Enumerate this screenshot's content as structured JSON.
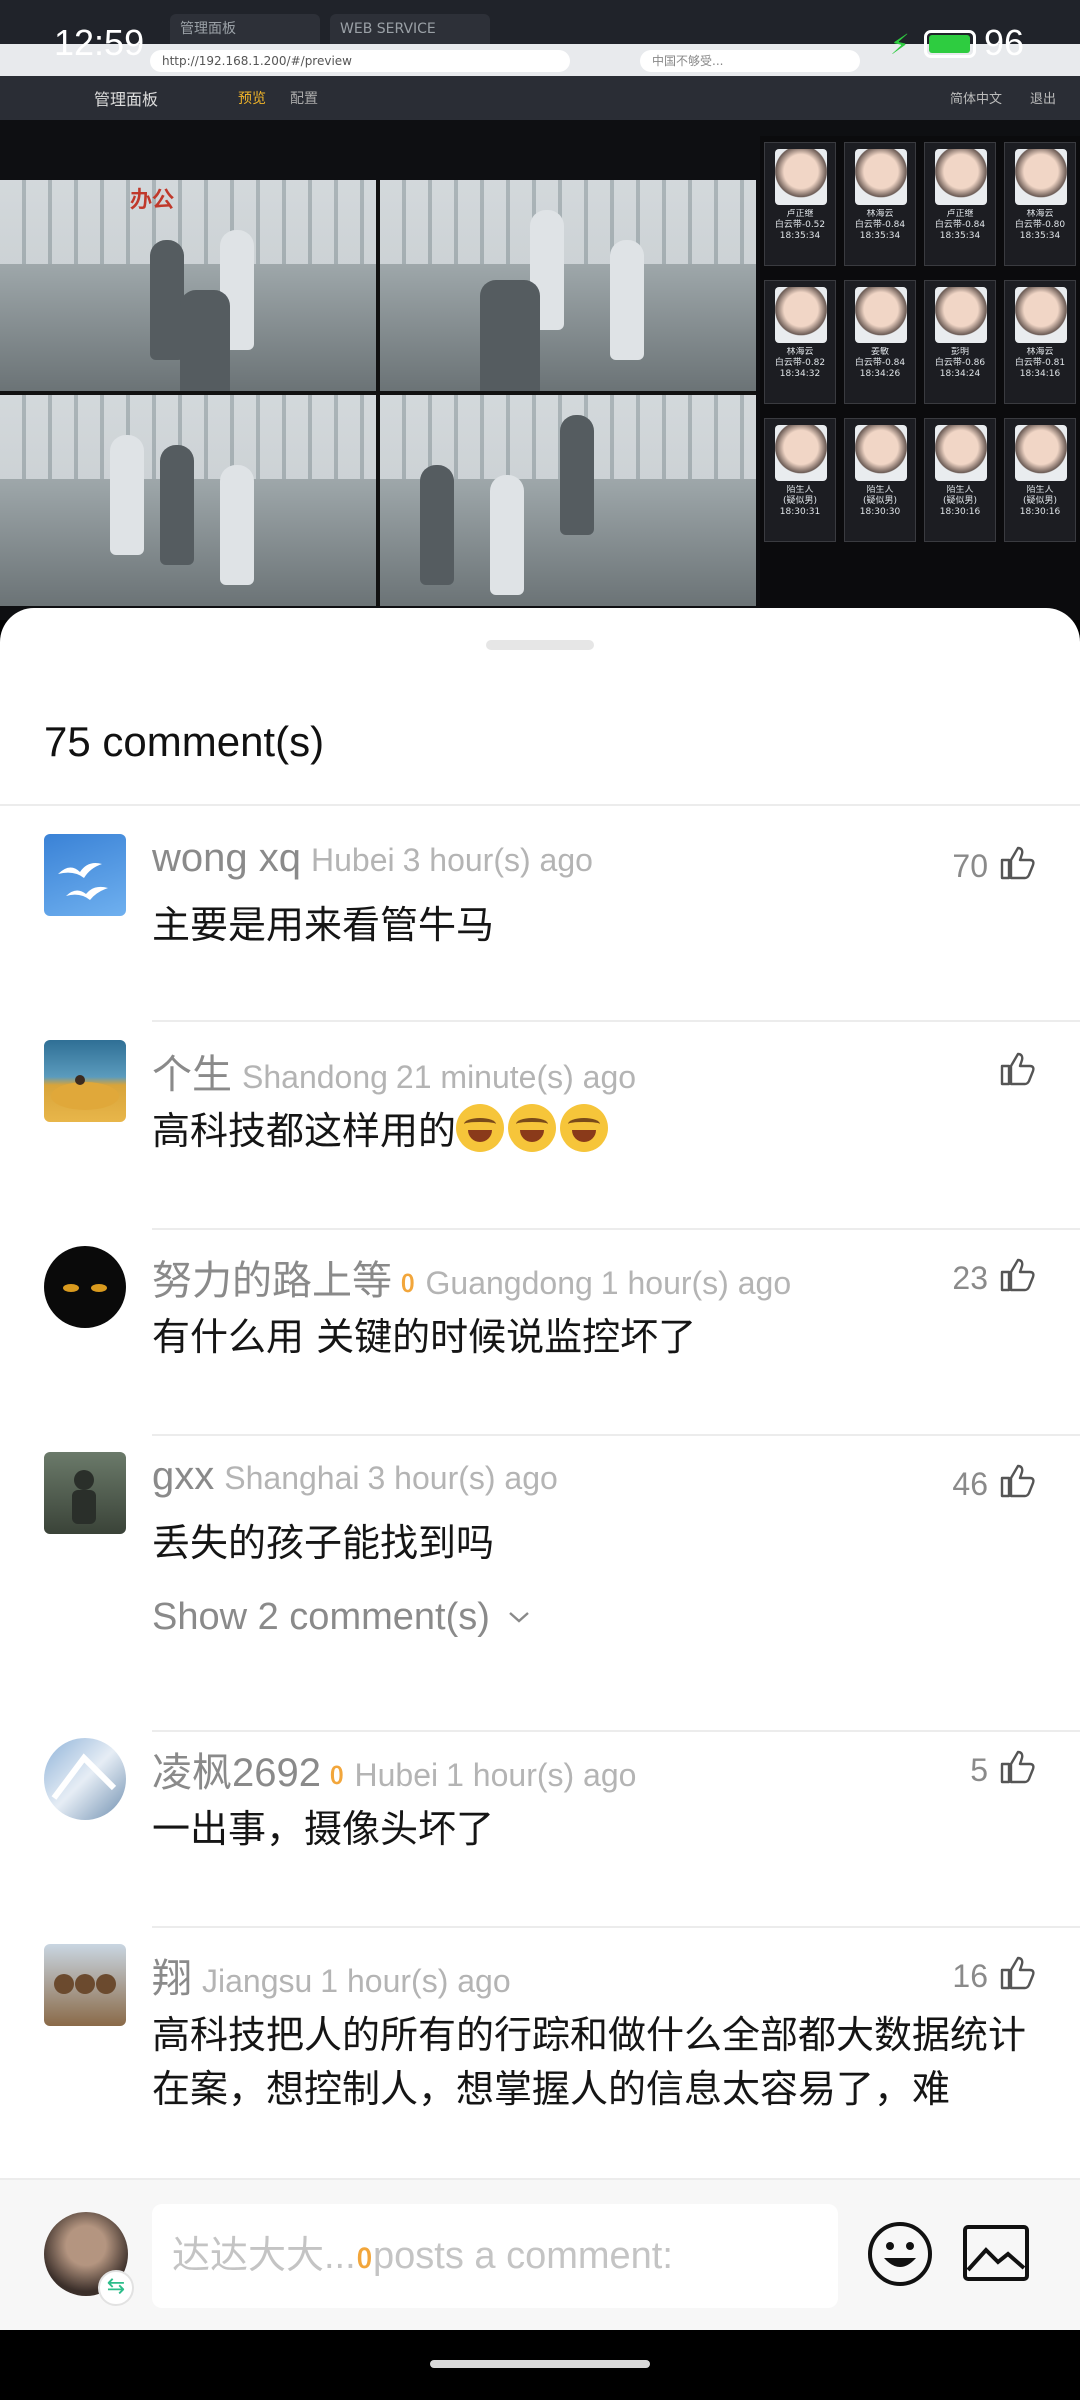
{
  "status_bar": {
    "time": "12:59",
    "battery_level": "96",
    "battery_percent": 96
  },
  "browser": {
    "tabs": [
      "管理面板",
      "WEB SERVICE"
    ],
    "address": "http://192.168.1.200/#/preview",
    "search_placeholder": "中国不够受..."
  },
  "management_bar": {
    "title": "管理面板",
    "tabs": [
      {
        "label": "预览",
        "active": true
      },
      {
        "label": "配置",
        "active": false
      }
    ],
    "right_items": [
      "简体中文",
      "退出"
    ]
  },
  "camera_panel": {
    "sign_text": "办公",
    "face_captions": [
      [
        "卢正继",
        "白云带-0.52",
        "18:35:34"
      ],
      [
        "林海云",
        "白云带-0.84",
        "18:35:34"
      ],
      [
        "卢正继",
        "白云带-0.84",
        "18:35:34"
      ],
      [
        "林海云",
        "白云带-0.80",
        "18:35:34"
      ],
      [
        "林海云",
        "白云带-0.82",
        "18:34:32"
      ],
      [
        "姜敏",
        "白云带-0.84",
        "18:34:26"
      ],
      [
        "彭明",
        "白云带-0.86",
        "18:34:24"
      ],
      [
        "林海云",
        "白云带-0.81",
        "18:34:16"
      ],
      [
        "陌生人",
        "(疑似男)",
        "18:30:31"
      ],
      [
        "陌生人",
        "(疑似男)",
        "18:30:30"
      ],
      [
        "陌生人",
        "(疑似男)",
        "18:30:16"
      ],
      [
        "陌生人",
        "(疑似男)",
        "18:30:16"
      ]
    ]
  },
  "comments_sheet": {
    "title": "75 comment(s)",
    "comments": [
      {
        "user": "wong xq",
        "location": "Hubei",
        "time": "3 hour(s) ago",
        "likes": "70",
        "text": "主要是用来看管牛马"
      },
      {
        "user": "个生",
        "location": "Shandong",
        "time": "21 minute(s) ago",
        "likes": "",
        "text": "高科技都这样用的",
        "emoji_count": 3
      },
      {
        "user": "努力的路上等",
        "badge": "ᲂ",
        "location": "Guangdong",
        "time": "1 hour(s) ago",
        "likes": "23",
        "text": "有什么用 关键的时候说监控坏了"
      },
      {
        "user": "gxx",
        "location": "Shanghai",
        "time": "3 hour(s) ago",
        "likes": "46",
        "text": "丢失的孩子能找到吗",
        "show_more": "Show 2 comment(s)"
      },
      {
        "user": "凌枫2692",
        "badge": "ᲂ",
        "location": "Hubei",
        "time": "1 hour(s) ago",
        "likes": "5",
        "text": "一出事，摄像头坏了"
      },
      {
        "user": "翔",
        "location": "Jiangsu",
        "time": "1 hour(s) ago",
        "likes": "16",
        "text": "高科技把人的所有的行踪和做什么全部都大数据统计在案，想控制人，想掌握人的信息太容易了，难"
      }
    ]
  },
  "input_bar": {
    "placeholder_name": "达达大大...",
    "placeholder_badge": "ᲂ",
    "placeholder_suffix": "posts a comment:"
  },
  "colors": {
    "accent_badge": "#f2a63b",
    "battery": "#2ecc40",
    "switch_badge": "#2dbd8a"
  },
  "icons": [
    "thumbs-up-icon",
    "smiley-icon",
    "image-icon",
    "account-switch-icon",
    "chevron-down-icon",
    "drag-handle"
  ]
}
